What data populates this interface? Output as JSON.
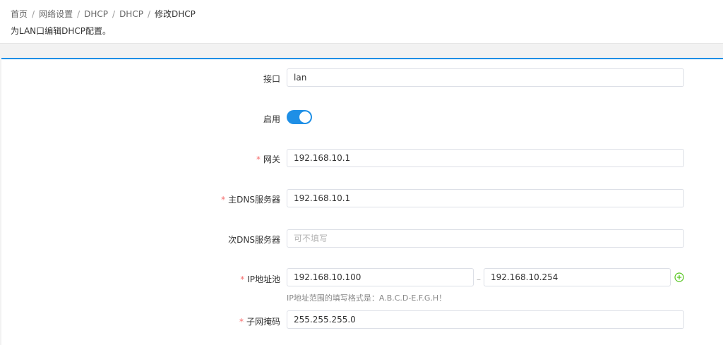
{
  "breadcrumb": {
    "items": [
      "首页",
      "网络设置",
      "DHCP",
      "DHCP"
    ],
    "current": "修改DHCP",
    "separator": "/"
  },
  "page": {
    "description": "为LAN口编辑DHCP配置。"
  },
  "form": {
    "interface": {
      "label": "接口",
      "value": "lan"
    },
    "enabled": {
      "label": "启用",
      "on": true
    },
    "gateway": {
      "label": "网关",
      "required": "*",
      "value": "192.168.10.1"
    },
    "primary_dns": {
      "label": "主DNS服务器",
      "required": "*",
      "value": "192.168.10.1"
    },
    "secondary_dns": {
      "label": "次DNS服务器",
      "placeholder": "可不填写",
      "value": ""
    },
    "ip_pool": {
      "label": "IP地址池",
      "required": "*",
      "start": "192.168.10.100",
      "end": "192.168.10.254",
      "range_separator": "–",
      "hint": "IP地址范围的填写格式是：A.B.C.D-E.F.G.H！"
    },
    "netmask": {
      "label": "子网掩码",
      "required": "*",
      "value": "255.255.255.0"
    }
  },
  "colors": {
    "accent": "#1e8fe6",
    "required": "#f56c6c",
    "add_icon": "#52c41a"
  }
}
